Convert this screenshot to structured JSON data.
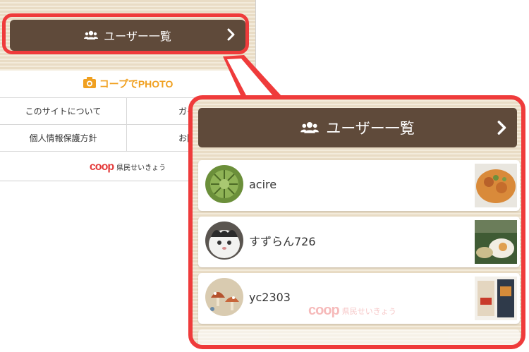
{
  "left_screen": {
    "user_list_button": "ユーザー一覧",
    "logo_text": "コープでPHOTO",
    "links": [
      "このサイトについて",
      "ガイド",
      "個人情報保護方針",
      "お問い"
    ],
    "coop_logo": "coop",
    "coop_name": "県民せいきょう"
  },
  "zoom_panel": {
    "user_list_button": "ユーザー一覧",
    "users": [
      {
        "name": "acire"
      },
      {
        "name": "すずらん726"
      },
      {
        "name": "yc2303"
      }
    ],
    "watermark_logo": "coop",
    "watermark_name": "県民せいきょう"
  },
  "colors": {
    "highlight": "#ef3b3b",
    "button_brown": "#5f4a3a",
    "wood_bg": "#efe4cf",
    "logo_orange": "#f0a020",
    "coop_red": "#e43a3a"
  },
  "icons": [
    "users-icon",
    "chevron-right-icon",
    "camera-icon"
  ]
}
